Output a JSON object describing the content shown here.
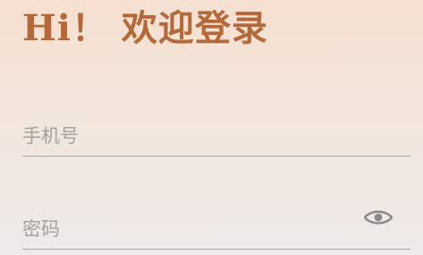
{
  "login": {
    "title": "Hi！ 欢迎登录",
    "phone_placeholder": "手机号",
    "password_placeholder": "密码",
    "visibility_icon": "eye-icon"
  },
  "colors": {
    "title": "#b4693a",
    "placeholder": "#a3a19f",
    "underline": "#a9a6a5",
    "icon": "#8a8a8a"
  }
}
